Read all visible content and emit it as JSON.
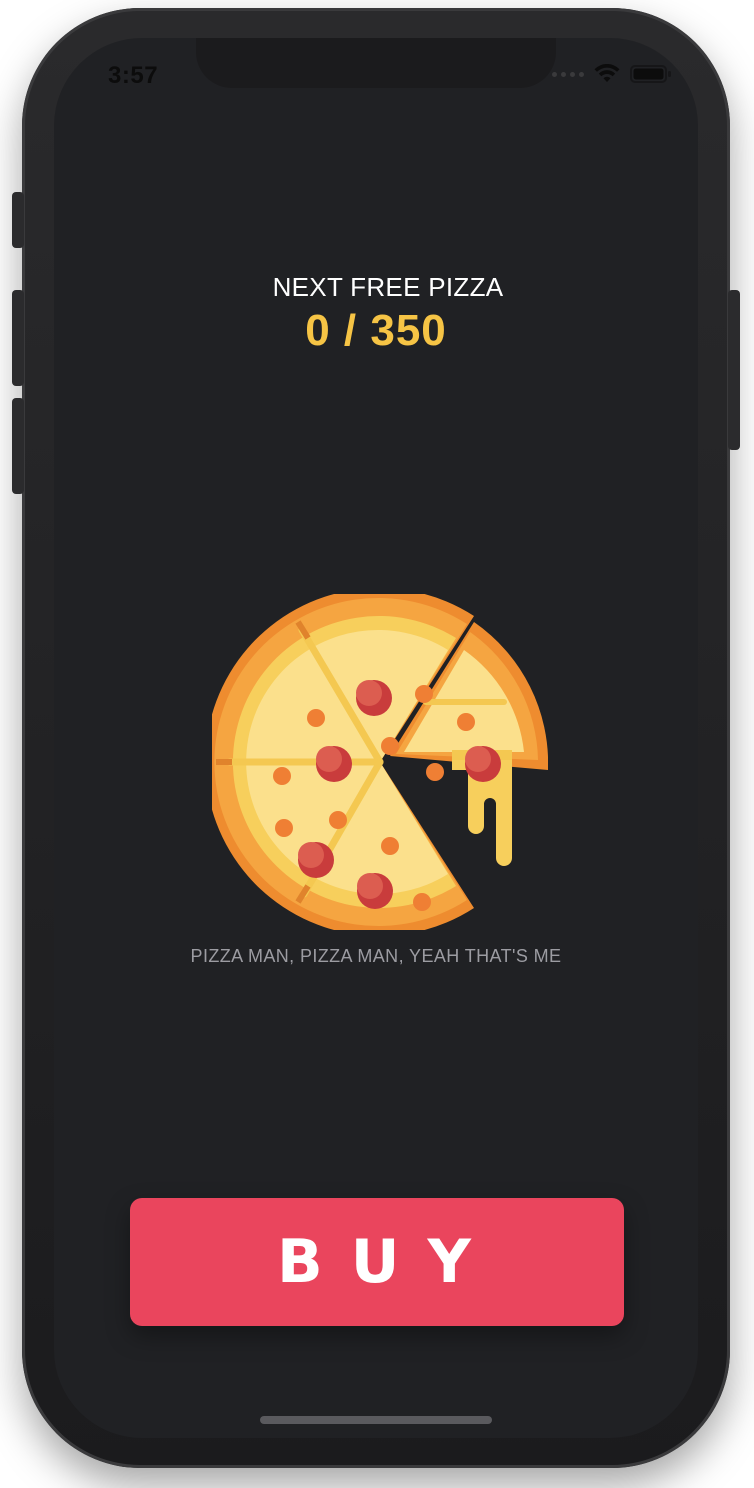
{
  "status_bar": {
    "time": "3:57",
    "icons": [
      "cellular-signal-icon",
      "wifi-icon",
      "battery-icon"
    ]
  },
  "reward": {
    "label": "NEXT FREE PIZZA",
    "progress_text": "0 / 350",
    "current": 0,
    "target": 350
  },
  "illustration": {
    "icon": "pizza-icon"
  },
  "tagline": "PIZZA MAN, PIZZA MAN, YEAH THAT'S ME",
  "buy_button": {
    "label": "BUY"
  },
  "colors": {
    "background": "#202124",
    "accent_yellow": "#f6c445",
    "button_red": "#ea455d",
    "tagline_gray": "#9c9ca2"
  }
}
